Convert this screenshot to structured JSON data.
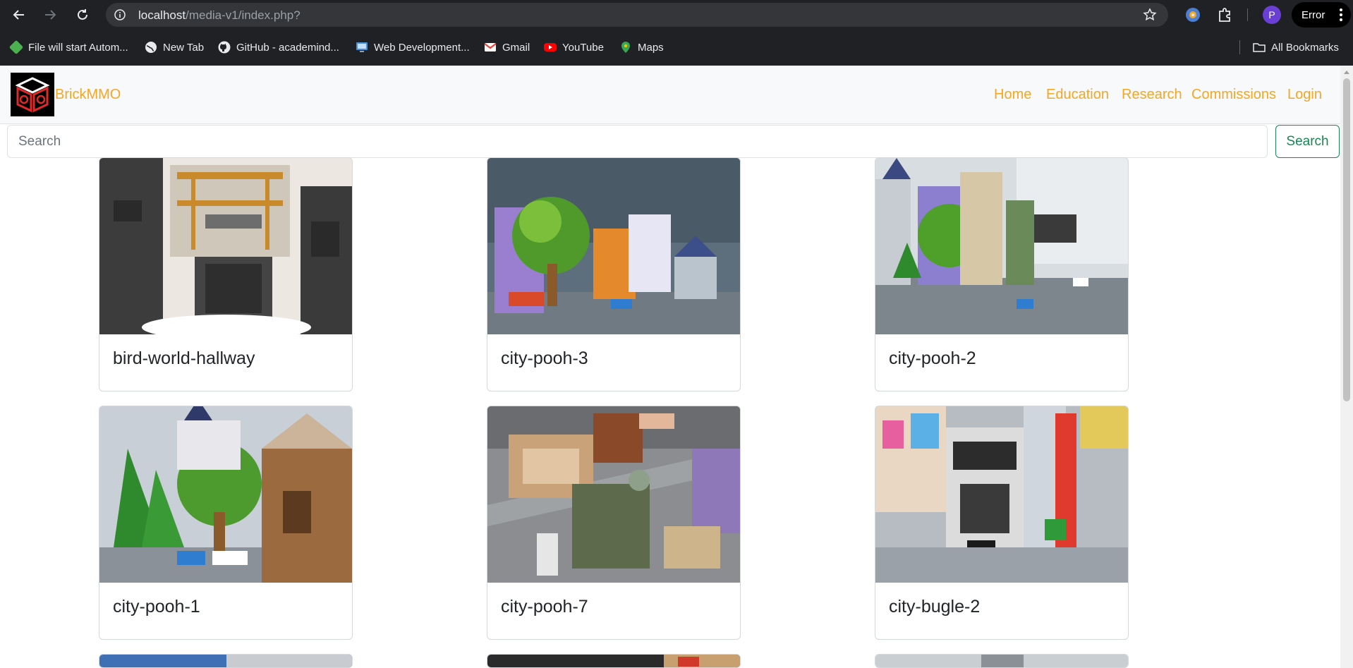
{
  "browser": {
    "url_host": "localhost",
    "url_path": "/media-v1/index.php?",
    "profile_initial": "P",
    "error_label": "Error",
    "bookmarks": [
      {
        "label": "File will start Autom...",
        "icon": "cube-icon",
        "color": "#4caf50"
      },
      {
        "label": "New Tab",
        "icon": "globe-icon",
        "color": "#e8eaed"
      },
      {
        "label": "GitHub - academind...",
        "icon": "github-icon",
        "color": "#e8eaed"
      },
      {
        "label": "Web Development...",
        "icon": "monitor-icon",
        "color": "#4a90d9"
      },
      {
        "label": "Gmail",
        "icon": "gmail-icon",
        "color": "#ea4335"
      },
      {
        "label": "YouTube",
        "icon": "youtube-icon",
        "color": "#ff0000"
      },
      {
        "label": "Maps",
        "icon": "maps-icon",
        "color": "#34a853"
      }
    ],
    "all_bookmarks_label": "All Bookmarks"
  },
  "site": {
    "brand": "BrickMMO",
    "brand_color": "#f5a623",
    "nav": [
      "Home",
      "Education",
      "Research",
      "Commissions",
      "Login"
    ]
  },
  "search": {
    "placeholder": "Search",
    "button_label": "Search",
    "accent": "#198754"
  },
  "gallery": {
    "items": [
      {
        "title": "bird-world-hallway",
        "palette": [
          "#ece7e0",
          "#3a3a3a",
          "#c88a2a"
        ]
      },
      {
        "title": "city-pooh-3",
        "palette": [
          "#5d6f7c",
          "#7bbf3a",
          "#9a7fd0"
        ]
      },
      {
        "title": "city-pooh-2",
        "palette": [
          "#d8dde2",
          "#4fa02b",
          "#8d7fcf"
        ]
      },
      {
        "title": "city-pooh-1",
        "palette": [
          "#c9cfd6",
          "#2f8a2e",
          "#9b6a3e"
        ]
      },
      {
        "title": "city-pooh-7",
        "palette": [
          "#8b8d90",
          "#c9a27a",
          "#5d6a4c"
        ]
      },
      {
        "title": "city-bugle-2",
        "palette": [
          "#b7bcc2",
          "#e0392d",
          "#2c2c2c"
        ]
      }
    ]
  }
}
